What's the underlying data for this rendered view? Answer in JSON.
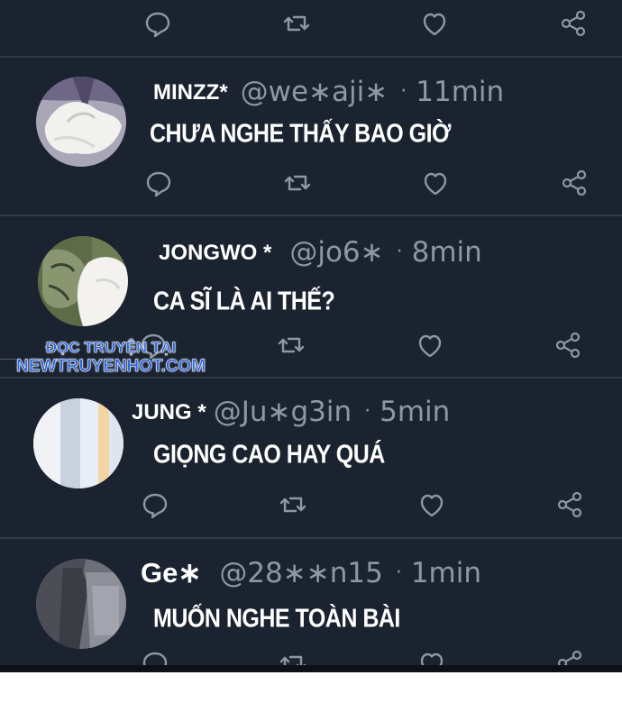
{
  "colors": {
    "background": "#1b2330",
    "divider": "#2e3846",
    "muted": "#8b98a5",
    "text": "#ffffff",
    "watermark": "#2b63d9"
  },
  "actions": {
    "reply_icon": "reply-icon",
    "retweet_icon": "retweet-icon",
    "like_icon": "heart-icon",
    "share_icon": "share-icon"
  },
  "tweets": [
    {
      "name": "MINZZ*",
      "handle": "@we∗aji∗",
      "sep": "·",
      "time": "11min",
      "text": "CHƯA NGHE THẤY BAO GIỜ"
    },
    {
      "name": "JONGWO *",
      "handle": "@jo6∗",
      "sep": "·",
      "time": "8min",
      "text": "CA SĨ LÀ AI THẾ?"
    },
    {
      "name": "JUNG *",
      "handle": "@Ju∗g3in",
      "sep": "·",
      "time": "5min",
      "text": "GIỌNG CAO HAY QUÁ"
    },
    {
      "name": "Ge∗",
      "handle": "@28∗∗n15",
      "sep": "·",
      "time": "1min",
      "text": "MUỐN NGHE TOÀN BÀI"
    }
  ],
  "watermark": {
    "line1": "ĐỌC TRUYỆN TẠI",
    "line2": "NEWTRUYENHOT.COM"
  }
}
